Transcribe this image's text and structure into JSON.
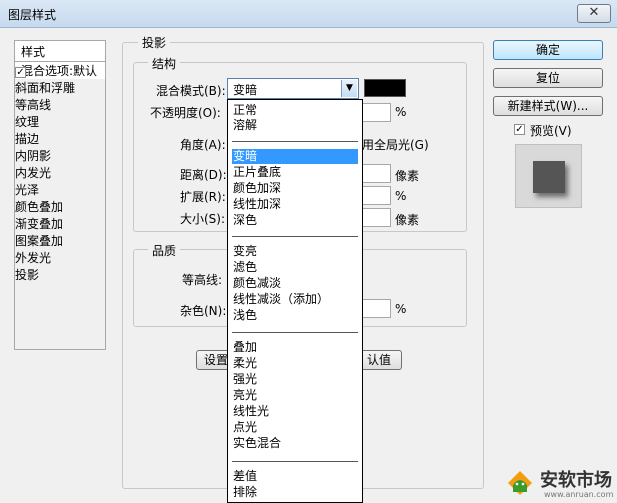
{
  "window": {
    "title": "图层样式",
    "close_glyph": "✕"
  },
  "sidebar": {
    "header": "样式",
    "items": [
      {
        "label": "混合选项:默认",
        "checkbox": false
      },
      {
        "label": "斜面和浮雕",
        "checkbox": true,
        "checked": false
      },
      {
        "label": "等高线",
        "checkbox": true,
        "checked": false,
        "indent": true
      },
      {
        "label": "纹理",
        "checkbox": true,
        "checked": false,
        "indent": true
      },
      {
        "label": "描边",
        "checkbox": true,
        "checked": false
      },
      {
        "label": "内阴影",
        "checkbox": true,
        "checked": false
      },
      {
        "label": "内发光",
        "checkbox": true,
        "checked": false
      },
      {
        "label": "光泽",
        "checkbox": true,
        "checked": false
      },
      {
        "label": "颜色叠加",
        "checkbox": true,
        "checked": false
      },
      {
        "label": "渐变叠加",
        "checkbox": true,
        "checked": false
      },
      {
        "label": "图案叠加",
        "checkbox": true,
        "checked": false
      },
      {
        "label": "外发光",
        "checkbox": true,
        "checked": false
      },
      {
        "label": "投影",
        "checkbox": true,
        "checked": true,
        "selected": true
      }
    ]
  },
  "panel": {
    "title": "投影",
    "structure": {
      "title": "结构",
      "blend_label": "混合模式(B):",
      "blend_value": "变暗",
      "opacity_label": "不透明度(O):",
      "opacity_unit": "%",
      "angle_label": "角度(A):",
      "global_light_visible": "用全局光(G)",
      "distance_label": "距离(D):",
      "distance_unit": "像素",
      "spread_label": "扩展(R):",
      "spread_unit": "%",
      "size_label": "大小(S):",
      "size_unit": "像素"
    },
    "quality": {
      "title": "品质",
      "contour_label": "等高线:",
      "noise_label": "杂色(N):",
      "noise_unit": "%"
    },
    "set_default_visible": "设置",
    "reset_default_visible": "认值"
  },
  "dropdown": {
    "selected": "变暗",
    "groups": [
      [
        "正常",
        "溶解"
      ],
      [
        "变暗",
        "正片叠底",
        "颜色加深",
        "线性加深",
        "深色"
      ],
      [
        "变亮",
        "滤色",
        "颜色减淡",
        "线性减淡（添加）",
        "浅色"
      ],
      [
        "叠加",
        "柔光",
        "强光",
        "亮光",
        "线性光",
        "点光",
        "实色混合"
      ],
      [
        "差值",
        "排除"
      ]
    ]
  },
  "buttons": {
    "ok": "确定",
    "reset": "复位",
    "new_style": "新建样式(W)...",
    "preview_label": "预览(V)",
    "preview_checked": true
  },
  "watermark": {
    "brand": "安软市场",
    "url": "www.anruan.com"
  },
  "colors": {
    "selection": "#3399ff",
    "shadow_color": "#000000",
    "brand_green": "#3a9a2a",
    "brand_orange": "#f39c12"
  }
}
